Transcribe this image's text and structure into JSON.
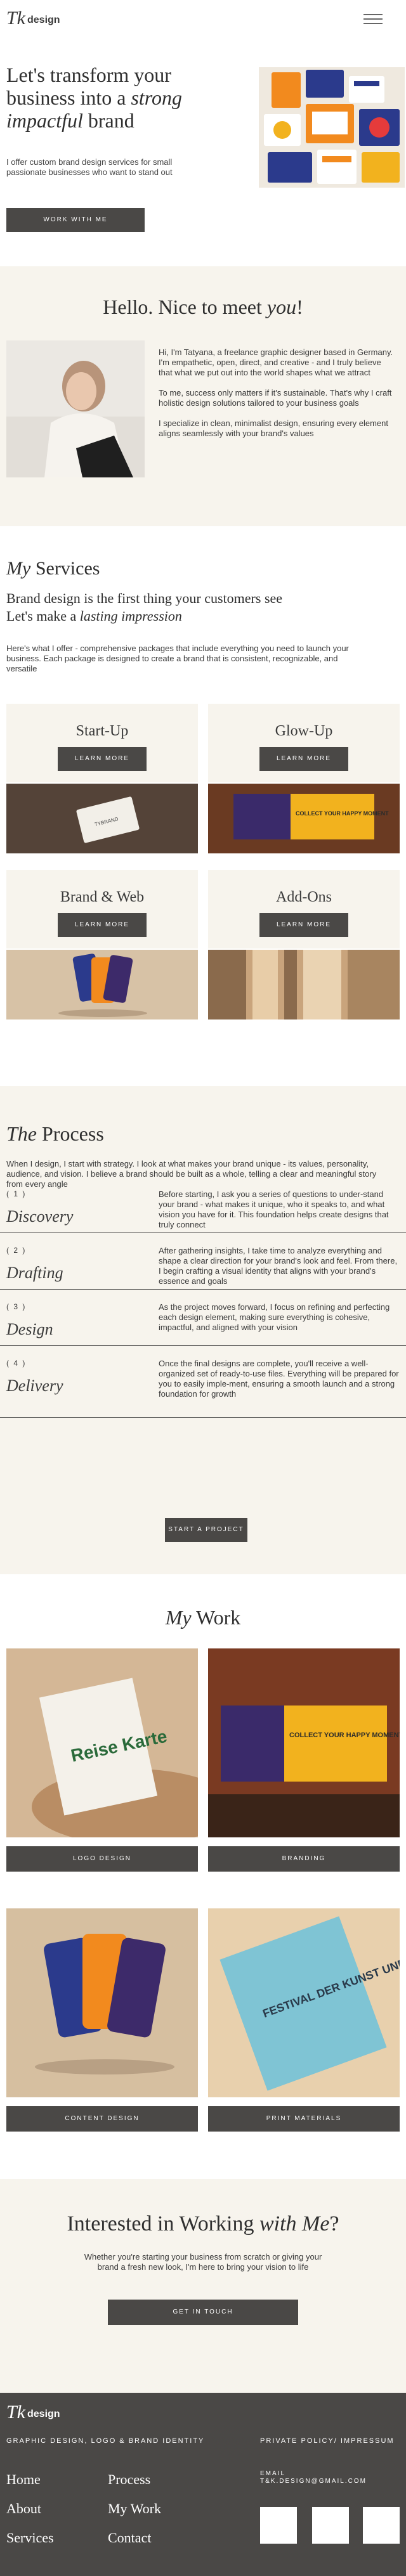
{
  "header": {
    "logo_mark": "Tk",
    "logo_word": "design",
    "menu_icon": "hamburger-menu-icon"
  },
  "hero": {
    "title_a": "Let's transform your business into a ",
    "title_em": "strong impactful",
    "title_b": " brand",
    "desc": "I offer custom brand design services for small passionate businesses who want to stand out",
    "button": "Work with me"
  },
  "meet": {
    "title_a": "Hello. Nice to meet ",
    "title_em": "you",
    "title_b": "!",
    "p1": "Hi, I'm Tatyana, a freelance graphic designer based in Germany. I'm empathetic, open, direct, and creative - and I truly believe that what we put out into the world shapes what we attract",
    "p2": "To me, success only matters if it's sustainable. That's why I craft holistic design solutions tailored to your business goals",
    "p3": "I specialize in clean, minimalist design, ensuring every element aligns seamlessly with your brand's values"
  },
  "services": {
    "title_em": "My",
    "title_b": " Services",
    "sub_a": "Brand design is the first thing your customers see",
    "sub_b": "Let's make a ",
    "sub_em": "lasting impression",
    "desc": "Here's what I offer - comprehensive packages that include everything you need to launch your business. Each package is designed to create a brand that is consistent, recognizable, and versatile",
    "items": [
      {
        "title": "Start-Up",
        "button": "Learn more"
      },
      {
        "title": "Glow-Up",
        "button": "Learn more"
      },
      {
        "title": "Brand & Web",
        "button": "Learn more"
      },
      {
        "title": "Add-Ons",
        "button": "Learn more"
      }
    ],
    "mockups": {
      "card_text": "TYBRAND",
      "banner_text": "COLLECT YOUR HAPPY MOMENT"
    }
  },
  "process": {
    "title_em": "The",
    "title_b": " Process",
    "intro": "When I design, I start with strategy. I look at what makes your brand unique - its values, personality, audience, and vision. I believe a brand should be built as a whole, telling a clear and meaningful story from every angle",
    "steps": [
      {
        "num": "( 1 )",
        "name": "Discovery",
        "desc": "Before starting, I ask you a series of questions to under-stand your brand - what makes it unique, who it speaks to, and what vision you have for it. This foundation helps create designs that truly connect"
      },
      {
        "num": "( 2 )",
        "name": "Drafting",
        "desc": "After gathering insights, I take time to analyze everything and shape a clear direction for your brand's look and feel. From there, I begin crafting a visual identity that aligns with your brand's essence and goals"
      },
      {
        "num": "( 3 )",
        "name": "Design",
        "desc": "As the project moves forward, I focus on refining and perfecting each design element, making sure everything is cohesive, impactful, and aligned with your vision"
      },
      {
        "num": "( 4 )",
        "name": "Delivery",
        "desc": "Once the final designs are complete, you'll receive a well-organized set of ready-to-use files. Everything will be prepared for you to easily imple-ment, ensuring a smooth launch and a strong foundation for growth"
      }
    ],
    "button": "Start a project"
  },
  "work": {
    "title_em": "My",
    "title_b": " Work",
    "items": [
      {
        "label": "Logo design"
      },
      {
        "label": "Branding"
      },
      {
        "label": "Content design"
      },
      {
        "label": "Print materials"
      }
    ],
    "mockups": {
      "logo_text": "Reise Karte",
      "poster_text": "FESTIVAL DER KUNST UND KULTUR"
    }
  },
  "contact": {
    "title_a": "Interested in Working ",
    "title_em": "with Me",
    "title_b": "?",
    "text": "Whether you're starting your business from scratch or giving your brand a fresh new look, I'm here to bring your vision to life",
    "button": "Get in touch"
  },
  "footer": {
    "logo_mark": "Tk",
    "logo_word": "design",
    "tagline": "Graphic design, logo & brand identity",
    "legal": "Private policy/ Impressum",
    "nav": [
      "Home",
      "Process",
      "About",
      "My Work",
      "Services",
      "Contact"
    ],
    "email_label": "Email",
    "email": "t&k.design@gmail.com",
    "social_icons": [
      "instagram-icon",
      "pinterest-icon",
      "linkedin-icon"
    ]
  },
  "colors": {
    "dark_button": "#4a4846",
    "cream": "#f7f4ed",
    "text": "#3a3a3a"
  }
}
